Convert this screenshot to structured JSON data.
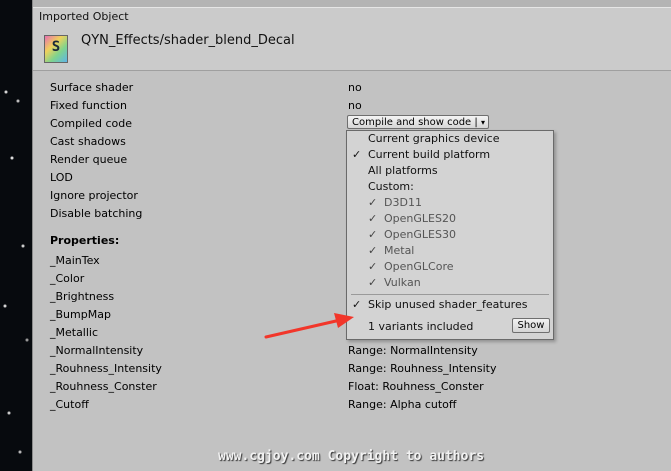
{
  "header": {
    "title": "Imported Object"
  },
  "asset": {
    "icon": "shader-file-icon",
    "icon_glyph": "S",
    "name": "QYN_Effects/shader_blend_Decal"
  },
  "info_rows": [
    {
      "label": "Surface shader",
      "value": "no"
    },
    {
      "label": "Fixed function",
      "value": "no"
    },
    {
      "label": "Compiled code",
      "value": ""
    },
    {
      "label": "Cast shadows",
      "value": ""
    },
    {
      "label": "Render queue",
      "value": ""
    },
    {
      "label": "LOD",
      "value": ""
    },
    {
      "label": "Ignore projector",
      "value": ""
    },
    {
      "label": "Disable batching",
      "value": ""
    }
  ],
  "compile_button": {
    "label": "Compile and show code |",
    "arrow": "▾"
  },
  "properties_heading": "Properties:",
  "properties": [
    {
      "name": "_MainTex",
      "value": ""
    },
    {
      "name": "_Color",
      "value": ""
    },
    {
      "name": "_Brightness",
      "value": ""
    },
    {
      "name": "_BumpMap",
      "value": ""
    },
    {
      "name": "_Metallic",
      "value": ""
    },
    {
      "name": "_NormalIntensity",
      "value": "Range: NormalIntensity"
    },
    {
      "name": "_Rouhness_Intensity",
      "value": "Range: Rouhness_Intensity"
    },
    {
      "name": "_Rouhness_Conster",
      "value": "Float: Rouhness_Conster"
    },
    {
      "name": "_Cutoff",
      "value": "Range: Alpha cutoff"
    }
  ],
  "dropdown": {
    "items": [
      {
        "label": "Current graphics device",
        "checked": false
      },
      {
        "label": "Current build platform",
        "checked": true
      },
      {
        "label": "All platforms",
        "checked": false
      },
      {
        "label": "Custom:",
        "checked": false
      }
    ],
    "custom_items": [
      {
        "label": "D3D11",
        "checked": true
      },
      {
        "label": "OpenGLES20",
        "checked": true
      },
      {
        "label": "OpenGLES30",
        "checked": true
      },
      {
        "label": "Metal",
        "checked": true
      },
      {
        "label": "OpenGLCore",
        "checked": true
      },
      {
        "label": "Vulkan",
        "checked": true
      }
    ],
    "skip_label": "Skip unused shader_features",
    "skip_checked": true,
    "variants_label": "1 variants included",
    "show_button": "Show",
    "check_glyph": "✓"
  },
  "watermark": "www.cgjoy.com Copyright to authors",
  "colors": {
    "panel": "#c2c2c2",
    "annotation_arrow": "#f2362a"
  }
}
